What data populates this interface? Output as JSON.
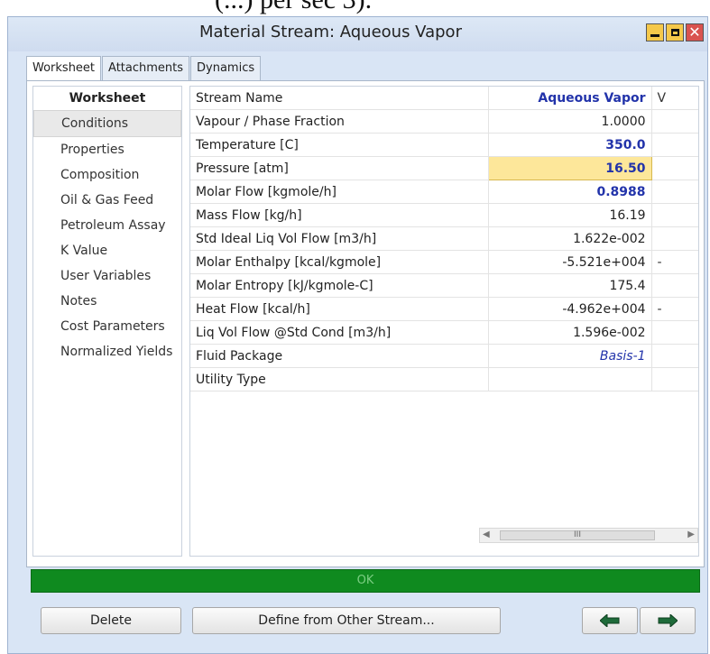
{
  "window": {
    "title": "Material Stream: Aqueous Vapor",
    "top_fragment": "(...) per sec 3)."
  },
  "tabs": [
    {
      "label": "Worksheet"
    },
    {
      "label": "Attachments"
    },
    {
      "label": "Dynamics"
    }
  ],
  "sidebar": {
    "header": "Worksheet",
    "items": [
      {
        "label": "Conditions"
      },
      {
        "label": "Properties"
      },
      {
        "label": "Composition"
      },
      {
        "label": "Oil & Gas Feed"
      },
      {
        "label": "Petroleum Assay"
      },
      {
        "label": "K Value"
      },
      {
        "label": "User Variables"
      },
      {
        "label": "Notes"
      },
      {
        "label": "Cost Parameters"
      },
      {
        "label": "Normalized Yields"
      }
    ]
  },
  "grid": {
    "rows": [
      {
        "name": "Stream Name",
        "value": "Aqueous Vapor",
        "extra": "V"
      },
      {
        "name": "Vapour / Phase Fraction",
        "value": "1.0000",
        "extra": ""
      },
      {
        "name": "Temperature [C]",
        "value": "350.0",
        "extra": ""
      },
      {
        "name": "Pressure [atm]",
        "value": "16.50",
        "extra": ""
      },
      {
        "name": "Molar Flow [kgmole/h]",
        "value": "0.8988",
        "extra": ""
      },
      {
        "name": "Mass Flow [kg/h]",
        "value": "16.19",
        "extra": ""
      },
      {
        "name": "Std Ideal Liq Vol Flow [m3/h]",
        "value": "1.622e-002",
        "extra": ""
      },
      {
        "name": "Molar Enthalpy [kcal/kgmole]",
        "value": "-5.521e+004",
        "extra": "-"
      },
      {
        "name": "Molar Entropy [kJ/kgmole-C]",
        "value": "175.4",
        "extra": ""
      },
      {
        "name": "Heat Flow [kcal/h]",
        "value": "-4.962e+004",
        "extra": "-"
      },
      {
        "name": "Liq Vol Flow @Std Cond [m3/h]",
        "value": "1.596e-002",
        "extra": ""
      },
      {
        "name": "Fluid Package",
        "value": "Basis-1",
        "extra": ""
      },
      {
        "name": "Utility Type",
        "value": "",
        "extra": ""
      }
    ]
  },
  "scrollbar": {
    "thumb_label": "III"
  },
  "status": {
    "text": "OK"
  },
  "buttons": {
    "delete": "Delete",
    "define": "Define from Other Stream..."
  },
  "icons": {
    "prev": "left-arrow-icon",
    "next": "right-arrow-icon"
  },
  "colors": {
    "status_bg": "#0f8a1f",
    "highlight": "#fde79a",
    "value_blue": "#2233aa"
  }
}
